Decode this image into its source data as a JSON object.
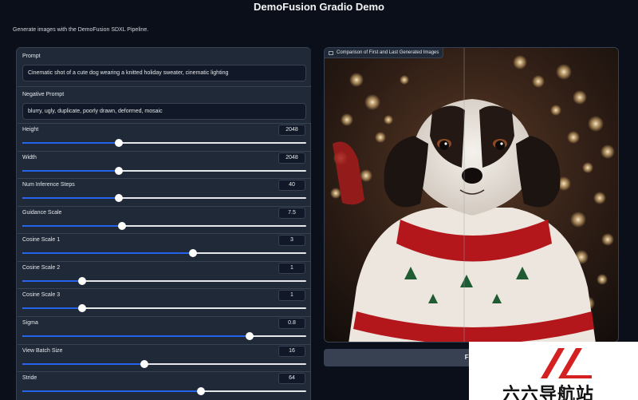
{
  "app": {
    "title": "DemoFusion Gradio Demo",
    "subtitle": "Generate images with the DemoFusion SDXL Pipeline."
  },
  "prompt": {
    "label": "Prompt",
    "value": "Cinematic shot of a cute dog wearing a knitted holiday sweater, cinematic lighting"
  },
  "negative_prompt": {
    "label": "Negative Prompt",
    "value": "blurry, ugly, duplicate, poorly drawn, deformed, mosaic"
  },
  "sliders": [
    {
      "key": "height",
      "label": "Height",
      "value": "2048",
      "fraction": 0.34
    },
    {
      "key": "width",
      "label": "Width",
      "value": "2048",
      "fraction": 0.34
    },
    {
      "key": "num-inference-steps",
      "label": "Num Inference Steps",
      "value": "40",
      "fraction": 0.34
    },
    {
      "key": "guidance-scale",
      "label": "Guidance Scale",
      "value": "7.5",
      "fraction": 0.35
    },
    {
      "key": "cosine-scale-1",
      "label": "Cosine Scale 1",
      "value": "3",
      "fraction": 0.6
    },
    {
      "key": "cosine-scale-2",
      "label": "Cosine Scale 2",
      "value": "1",
      "fraction": 0.21
    },
    {
      "key": "cosine-scale-3",
      "label": "Cosine Scale 3",
      "value": "1",
      "fraction": 0.21
    },
    {
      "key": "sigma",
      "label": "Sigma",
      "value": "0.8",
      "fraction": 0.8
    },
    {
      "key": "view-batch-size",
      "label": "View Batch Size",
      "value": "16",
      "fraction": 0.43
    },
    {
      "key": "stride",
      "label": "Stride",
      "value": "64",
      "fraction": 0.63
    }
  ],
  "output": {
    "label": "Comparison of First and Last Generated Images"
  },
  "flag_button": {
    "label": "Flag"
  },
  "watermark": {
    "text": "六六导航站"
  },
  "colors": {
    "background": "#0b0f19",
    "panel": "#1f2937",
    "accent": "#2563eb",
    "watermark_red": "#d42020"
  },
  "icons": [
    "image-icon",
    "watermark-logo-icon"
  ]
}
